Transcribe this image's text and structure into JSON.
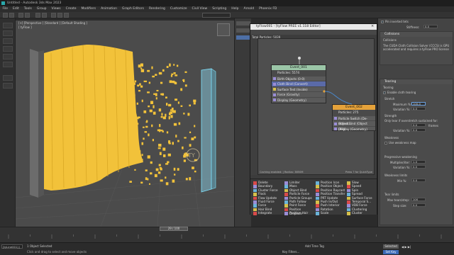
{
  "window": {
    "title": "Untitled - Autodesk 3ds Max 2023"
  },
  "menu": [
    "File",
    "Edit",
    "Tools",
    "Group",
    "Views",
    "Create",
    "Modifiers",
    "Animation",
    "Graph Editors",
    "Rendering",
    "Customize",
    "Civil View",
    "Scripting",
    "Help",
    "Arnold",
    "Phoenix FD"
  ],
  "viewport": {
    "label": "[+] [Perspective ] [Standard ] [Default Shading ]",
    "sublabel": "[ tyFlow ]"
  },
  "editor": {
    "title": "tyFlow001 - [tyFlow PREE v1.118 Editor]",
    "total_particles": "Total Particles: 5039",
    "event1": {
      "name": "Event_001",
      "count": "Particles: 5574",
      "operators": [
        "Birth Objects (0-0)",
        "Cloth Bind (Convert)",
        "Surface Test (Inside)",
        "Force (Gravity)",
        "Display (Geometry)"
      ]
    },
    "event2": {
      "name": "Event_002",
      "count": "Particles: 275",
      "operators": [
        "Particle Switch (De-activat...",
        "Object Bind (Object [PB])",
        "Display (Geometry)"
      ]
    },
    "footer_left": "Caching enabled: | Radius: 3850M",
    "footer_right": "Press ? for QuickType"
  },
  "depot": {
    "col1": [
      "Delete",
      "Boundary",
      "Cluster Force",
      "Flock",
      "Flow Update",
      "Fluid Force",
      "Force",
      "Hair Bind",
      "Integrate"
    ],
    "col2": [
      "Limiter",
      "Mass",
      "Object Bind",
      "Particle Force",
      "Particle Groups",
      "Path Follow",
      "Point Force",
      "Position Displace",
      "Position Hair"
    ],
    "col3": [
      "Position Icon",
      "Position Object",
      "Position Raycast",
      "Position Transfer",
      "PRT Update",
      "Push In/Out",
      "Push Interior",
      "Rotation",
      "Scale"
    ],
    "col4": [
      "Slow",
      "Speed",
      "Spin",
      "Spread",
      "Surface Force",
      "Temporal S...",
      "VDB Force",
      "Clustering",
      "Cluster"
    ]
  },
  "rightpanel": {
    "pin_label": "Pin inverted tets",
    "stiffness_label": "Stiffness:",
    "stiffness_value": "0.0",
    "collisions_head": "Collisions",
    "collisions_sub": "Collisions",
    "collisions_text": "The CUDA Cloth Collision Solver (CCCS) is GPU accelerated and requires a tyFlow PRO license",
    "tearing_head": "Tearing",
    "tearing_sub": "Tearing",
    "enable_tearing": "Enable cloth tearing",
    "stretch_label": "Stretch",
    "maximum_label": "Maximum %:",
    "maximum_value": "100.0",
    "variation_label": "Variation %:",
    "variation_value": "0.0",
    "strength_label": "Strength",
    "strength_text": "Only tear if overstretch sustained for:",
    "strength_value": "0.0",
    "strength_frames": "frames",
    "weakness_label": "Weakness",
    "use_weakness": "Use weakness map",
    "progressive_label": "Progressive weakening",
    "multiplier_label": "Multiplier/iter:",
    "multiplier_value": "1.0",
    "variation2_value": "0.0",
    "limits_label": "Weakness limits",
    "min_label": "Min %:",
    "min_value": "0.0",
    "tear_limits": "Tear limits",
    "max_tears_label": "Max tears/step:",
    "max_tears_value": "100",
    "step_label": "Step size:",
    "step_value": "0.0"
  },
  "timeline": {
    "frame": "29 / 100"
  },
  "status": {
    "selected": "1 Object Selected",
    "hint": "Click and drag to select and move objects",
    "script_box": "[tyLine001] [",
    "selected_right": "Selected",
    "set_key": "Set Key",
    "key_filters": "Key Filters...",
    "add_time_tag": "Add Time Tag",
    "enabled": "Enabled:"
  },
  "colors": {
    "event1_head": "#9bc6a7",
    "event2_head": "#e5a23a",
    "cloth": "#f2c23a",
    "viewport_bg": "#4b4b4b"
  }
}
